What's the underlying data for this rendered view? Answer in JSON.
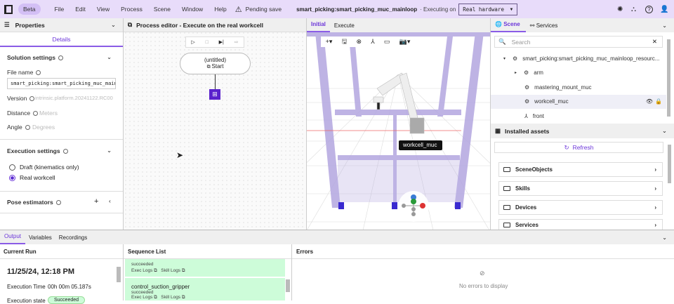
{
  "topbar": {
    "beta": "Beta",
    "menus": [
      "File",
      "Edit",
      "View",
      "Process",
      "Scene",
      "Window",
      "Help"
    ],
    "pending": "Pending save",
    "solution": "smart_picking:smart_picking_muc_mainloop",
    "executing_on": "· Executing on",
    "target": "Real hardware"
  },
  "properties": {
    "title": "Properties",
    "tab": "Details",
    "solution_settings": "Solution settings",
    "file_name_label": "File name",
    "file_name": "smart_picking:smart_picking_muc_mainloop",
    "version_label": "Version",
    "version": "intrinsic.platform.20241122.RC00",
    "distance_label": "Distance",
    "distance_placeholder": "Meters",
    "angle_label": "Angle",
    "angle_placeholder": "Degrees",
    "execution_settings": "Execution settings",
    "draft": "Draft (kinematics only)",
    "real": "Real workcell",
    "pose_estimators": "Pose estimators"
  },
  "process": {
    "title": "Process editor - Execute on the real workcell",
    "node_title": "(untitled)",
    "node_label": "Start"
  },
  "viewport": {
    "tabs": [
      "Initial",
      "Execute"
    ],
    "tooltip": "workcell_muc",
    "gizmo": [
      "Z",
      "Y",
      "X"
    ]
  },
  "scene": {
    "tabs": [
      "Scene",
      "Services"
    ],
    "search_placeholder": "Search",
    "tree": [
      "smart_picking:smart_picking_muc_mainloop_resourc...",
      "arm",
      "mastering_mount_muc",
      "workcell_muc",
      "front"
    ]
  },
  "assets": {
    "title": "Installed assets",
    "refresh": "Refresh",
    "items": [
      "SceneObjects",
      "Skills",
      "Devices",
      "Services"
    ]
  },
  "output": {
    "tabs": [
      "Output",
      "Variables",
      "Recordings"
    ],
    "current_run": "Current Run",
    "datetime": "11/25/24, 12:18 PM",
    "exec_time_label": "Execution Time",
    "exec_time": "00h 00m 05.187s",
    "state_label": "Execution state",
    "state": "Succeeded",
    "sequence_list": "Sequence List",
    "seq": [
      {
        "name": "",
        "status": "succeeded"
      },
      {
        "name": "control_suction_gripper",
        "status": "succeeded"
      }
    ],
    "exec_logs": "Exec Logs",
    "skill_logs": "Skill Logs",
    "errors": "Errors",
    "no_errors": "No errors to display"
  },
  "colors": {
    "accent": "#6b35d9",
    "topbar": "#e8dcfa",
    "success": "#cdfcd9"
  }
}
